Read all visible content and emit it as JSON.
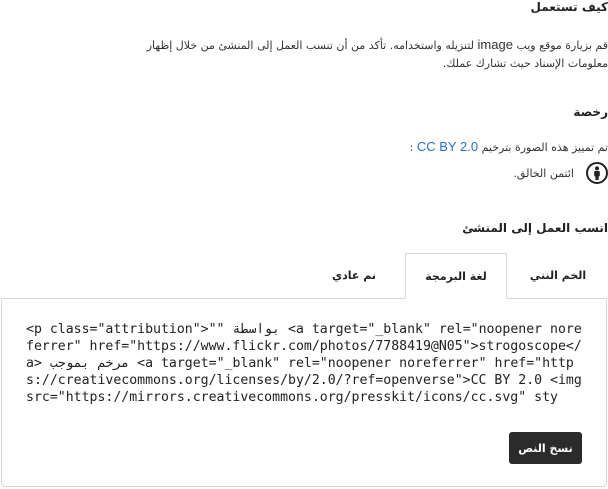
{
  "how_to_use": {
    "heading": "كيف تستعمل",
    "line1_prefix": "قم بزيارة موقع ويب",
    "line1_link": "image",
    "line1_suffix": "لتنزيله واستخدامه. تأكد من أن تنسب العمل إلى المنشئ من خلال إظهار",
    "line2": "معلومات الإسناد حيث تشارك عملك."
  },
  "license": {
    "heading": "رخصة",
    "text": "تم تمييز هذه الصورة بترخيم",
    "link": "CC BY 2.0",
    "colon": ":",
    "credit": "ائتمن الخالق."
  },
  "attribution": {
    "heading": "انسب العمل إلى المنشئ",
    "tabs": [
      "الخم النني",
      "لغة البرمجة",
      "نم عادي"
    ],
    "active_tab": "لغة البرمجة",
    "code": "<p class=\"attribution\">\"\" بواسطة <a target=\"_blank\" rel=\"noopener noreferrer\" href=\"https://www.flickr.com/photos/7788419@N05\">strogoscope</a> مرخم بموجب <a target=\"_blank\" rel=\"noopener noreferrer\" href=\"https://creativecommons.org/licenses/by/2.0/?ref=openverse\">CC BY 2.0 <img src=\"https://mirrors.creativecommons.org/presskit/icons/cc.svg\" sty",
    "copy_label": "نسخ النص"
  }
}
